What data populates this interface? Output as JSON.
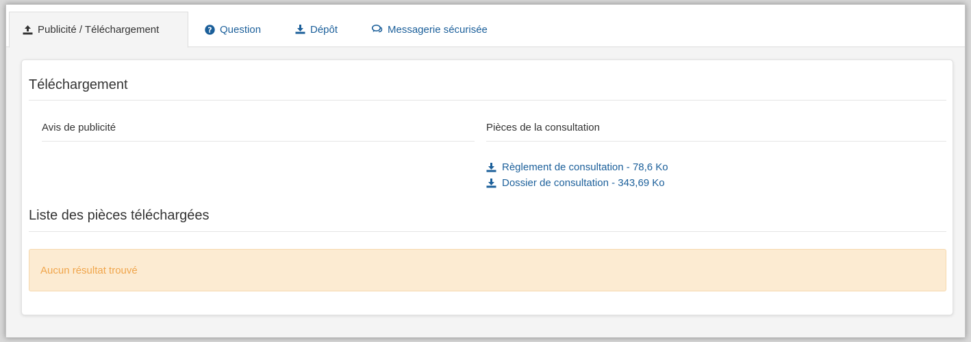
{
  "tabs": [
    {
      "label": "Publicité / Téléchargement",
      "icon": "upload-icon",
      "active": true
    },
    {
      "label": "Question",
      "icon": "question-circle-icon",
      "active": false
    },
    {
      "label": "Dépôt",
      "icon": "download-icon",
      "active": false
    },
    {
      "label": "Messagerie sécurisée",
      "icon": "chat-icon",
      "active": false
    }
  ],
  "download_section": {
    "title": "Téléchargement",
    "ad_column_label": "Avis de publicité",
    "files_column_label": "Pièces de la consultation",
    "files": [
      {
        "label": "Règlement de consultation - 78,6 Ko",
        "icon": "download-icon"
      },
      {
        "label": "Dossier de consultation - 343,69 Ko",
        "icon": "download-icon"
      }
    ]
  },
  "downloaded_section": {
    "title": "Liste des pièces téléchargées",
    "empty_message": "Aucun résultat trouvé"
  },
  "colors": {
    "link": "#1b5f9a",
    "warning_bg": "#fcebd2",
    "warning_text": "#f0a54b"
  }
}
